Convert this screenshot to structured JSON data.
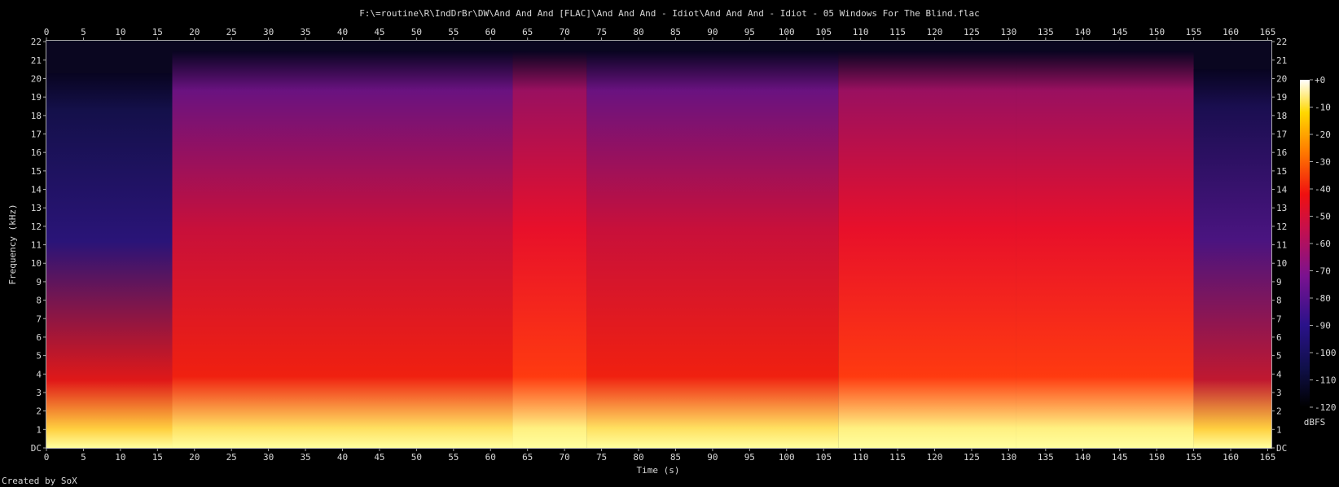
{
  "chart_data": {
    "type": "heatmap",
    "title": "F:\\=routine\\R\\IndDrBr\\DW\\And And And [FLAC]\\And And And - Idiot\\And And And - Idiot - 05 Windows For The Blind.flac",
    "xlabel": "Time (s)",
    "ylabel": "Frequency (kHz)",
    "xlim": [
      0,
      165.5
    ],
    "ylim": [
      0,
      22.05
    ],
    "x_ticks": [
      "0",
      "5",
      "10",
      "15",
      "20",
      "25",
      "30",
      "35",
      "40",
      "45",
      "50",
      "55",
      "60",
      "65",
      "70",
      "75",
      "80",
      "85",
      "90",
      "95",
      "100",
      "105",
      "110",
      "115",
      "120",
      "125",
      "130",
      "135",
      "140",
      "145",
      "150",
      "155",
      "160",
      "165"
    ],
    "y_ticks": [
      "DC",
      "1",
      "2",
      "3",
      "4",
      "5",
      "6",
      "7",
      "8",
      "9",
      "10",
      "11",
      "12",
      "13",
      "14",
      "15",
      "16",
      "17",
      "18",
      "19",
      "20",
      "21",
      "22"
    ],
    "colorbar": {
      "label": "dBFS",
      "ticks": [
        "+0",
        "-10",
        "-20",
        "-30",
        "-40",
        "-50",
        "-60",
        "-70",
        "-80",
        "-90",
        "-100",
        "-110",
        "-120"
      ],
      "range": [
        -120,
        0
      ]
    },
    "grid": false,
    "sections": [
      {
        "start": 0,
        "end": 17,
        "cutoff_khz": 20.3,
        "level": "quiet intro"
      },
      {
        "start": 17,
        "end": 63,
        "cutoff_khz": 21.5,
        "level": "full"
      },
      {
        "start": 63,
        "end": 73,
        "cutoff_khz": 21.5,
        "level": "loud"
      },
      {
        "start": 73,
        "end": 107,
        "cutoff_khz": 21.5,
        "level": "full"
      },
      {
        "start": 107,
        "end": 131,
        "cutoff_khz": 21.5,
        "level": "loud"
      },
      {
        "start": 131,
        "end": 155,
        "cutoff_khz": 21.5,
        "level": "loud"
      },
      {
        "start": 155,
        "end": 165.5,
        "cutoff_khz": 20.5,
        "level": "fade out"
      }
    ]
  },
  "footer": "Created by SoX"
}
